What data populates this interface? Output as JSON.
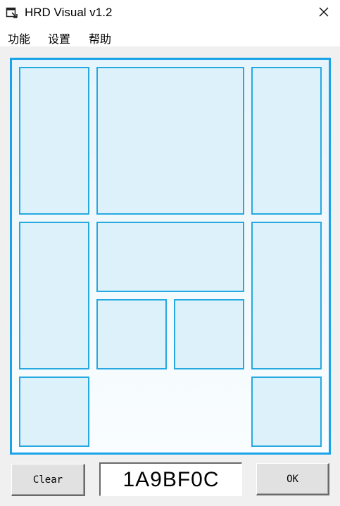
{
  "window": {
    "title": "HRD Visual v1.2"
  },
  "menu": {
    "items": [
      "功能",
      "设置",
      "帮助"
    ]
  },
  "board": {
    "rows": 5,
    "cols": 4,
    "pieces": [
      {
        "name": "piece-vertical-1",
        "col": 0,
        "row": 0,
        "w": 1,
        "h": 2
      },
      {
        "name": "piece-big-2x2",
        "col": 1,
        "row": 0,
        "w": 2,
        "h": 2
      },
      {
        "name": "piece-vertical-2",
        "col": 3,
        "row": 0,
        "w": 1,
        "h": 2
      },
      {
        "name": "piece-vertical-3",
        "col": 0,
        "row": 2,
        "w": 1,
        "h": 2
      },
      {
        "name": "piece-horizontal",
        "col": 1,
        "row": 2,
        "w": 2,
        "h": 1
      },
      {
        "name": "piece-vertical-4",
        "col": 3,
        "row": 2,
        "w": 1,
        "h": 2
      },
      {
        "name": "piece-small-1",
        "col": 1,
        "row": 3,
        "w": 1,
        "h": 1
      },
      {
        "name": "piece-small-2",
        "col": 2,
        "row": 3,
        "w": 1,
        "h": 1
      },
      {
        "name": "piece-small-3",
        "col": 0,
        "row": 4,
        "w": 1,
        "h": 1
      },
      {
        "name": "piece-small-4",
        "col": 3,
        "row": 4,
        "w": 1,
        "h": 1
      }
    ]
  },
  "controls": {
    "clear_label": "Clear",
    "code_value": "1A9BF0C",
    "ok_label": "OK"
  },
  "colors": {
    "board_border": "#1aa3e8",
    "piece_border": "#26a9e0",
    "piece_fill": "#ddf1fb"
  }
}
